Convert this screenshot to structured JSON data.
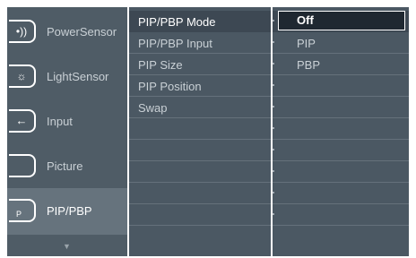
{
  "sidebar": {
    "items": [
      {
        "label": "PowerSensor",
        "icon": "power-sensor-icon"
      },
      {
        "label": "LightSensor",
        "icon": "light-sensor-icon"
      },
      {
        "label": "Input",
        "icon": "input-icon"
      },
      {
        "label": "Picture",
        "icon": "picture-icon"
      },
      {
        "label": "PIP/PBP",
        "icon": "pip-icon",
        "icon_text": "P"
      }
    ],
    "active_index": 4,
    "more_icon": "chevron-down-icon"
  },
  "menu": {
    "rows": [
      {
        "label": "PIP/PBP Mode"
      },
      {
        "label": "PIP/PBP Input"
      },
      {
        "label": "PIP Size"
      },
      {
        "label": "PIP Position"
      },
      {
        "label": "Swap"
      }
    ],
    "selected_index": 0
  },
  "options": {
    "items": [
      {
        "label": "Off"
      },
      {
        "label": "PIP"
      },
      {
        "label": "PBP"
      }
    ],
    "selected_index": 0
  },
  "colors": {
    "sidebar_bg": "#4f5c66",
    "panel_bg": "#4b5863",
    "selected_bg": "#1f2831",
    "text": "#c9d0d5",
    "highlight_text": "#ffffff"
  }
}
